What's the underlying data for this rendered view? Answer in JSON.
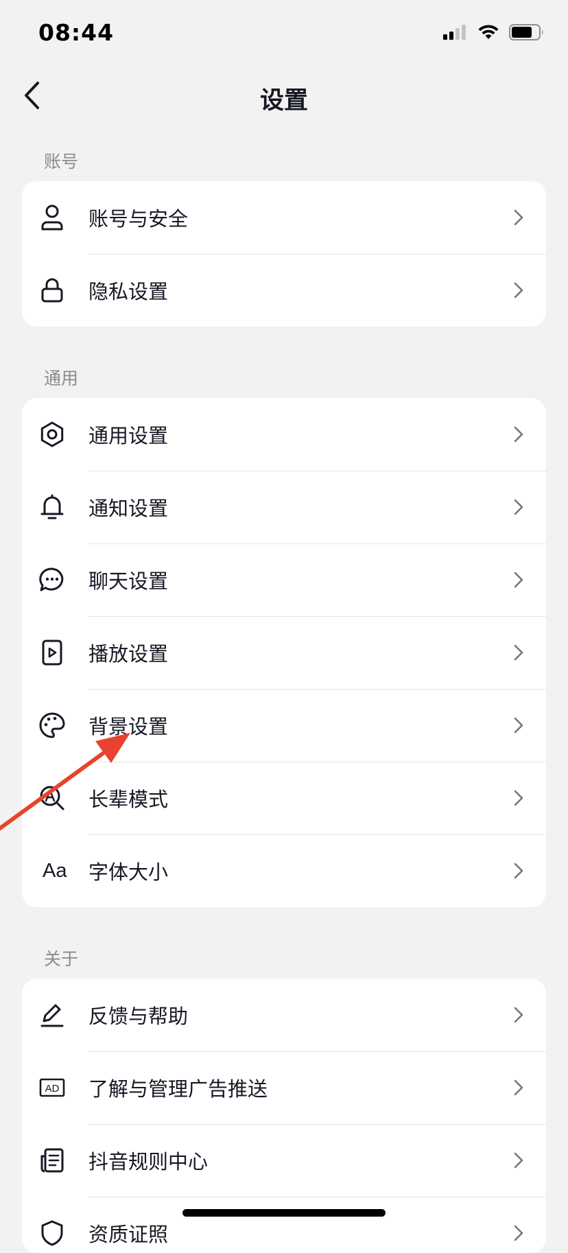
{
  "status_bar": {
    "time": "08:44",
    "signal_icon": "cellular-signal-icon",
    "wifi_icon": "wifi-icon",
    "battery_icon": "battery-icon"
  },
  "nav": {
    "title": "设置",
    "back_icon": "chevron-left-icon"
  },
  "sections": [
    {
      "header": "账号",
      "items": [
        {
          "label": "账号与安全",
          "icon": "user-icon"
        },
        {
          "label": "隐私设置",
          "icon": "lock-icon"
        }
      ]
    },
    {
      "header": "通用",
      "items": [
        {
          "label": "通用设置",
          "icon": "gear-icon"
        },
        {
          "label": "通知设置",
          "icon": "bell-icon"
        },
        {
          "label": "聊天设置",
          "icon": "chat-bubble-icon"
        },
        {
          "label": "播放设置",
          "icon": "play-icon"
        },
        {
          "label": "背景设置",
          "icon": "palette-icon"
        },
        {
          "label": "长辈模式",
          "icon": "magnifier-a-icon"
        },
        {
          "label": "字体大小",
          "icon": "font-size-icon",
          "icon_text": "Aa"
        }
      ]
    },
    {
      "header": "关于",
      "items": [
        {
          "label": "反馈与帮助",
          "icon": "pencil-icon"
        },
        {
          "label": "了解与管理广告推送",
          "icon": "ad-icon",
          "icon_text": "AD"
        },
        {
          "label": "抖音规则中心",
          "icon": "document-icon"
        },
        {
          "label": "资质证照",
          "icon": "shield-icon"
        }
      ]
    }
  ],
  "annotation": {
    "icon": "red-arrow-icon",
    "color": "#e8432e",
    "target": "背景设置"
  },
  "colors": {
    "background": "#f2f2f2",
    "card": "#ffffff",
    "text": "#161823",
    "secondary_text": "#8a8b91",
    "annotation_red": "#e8432e"
  }
}
